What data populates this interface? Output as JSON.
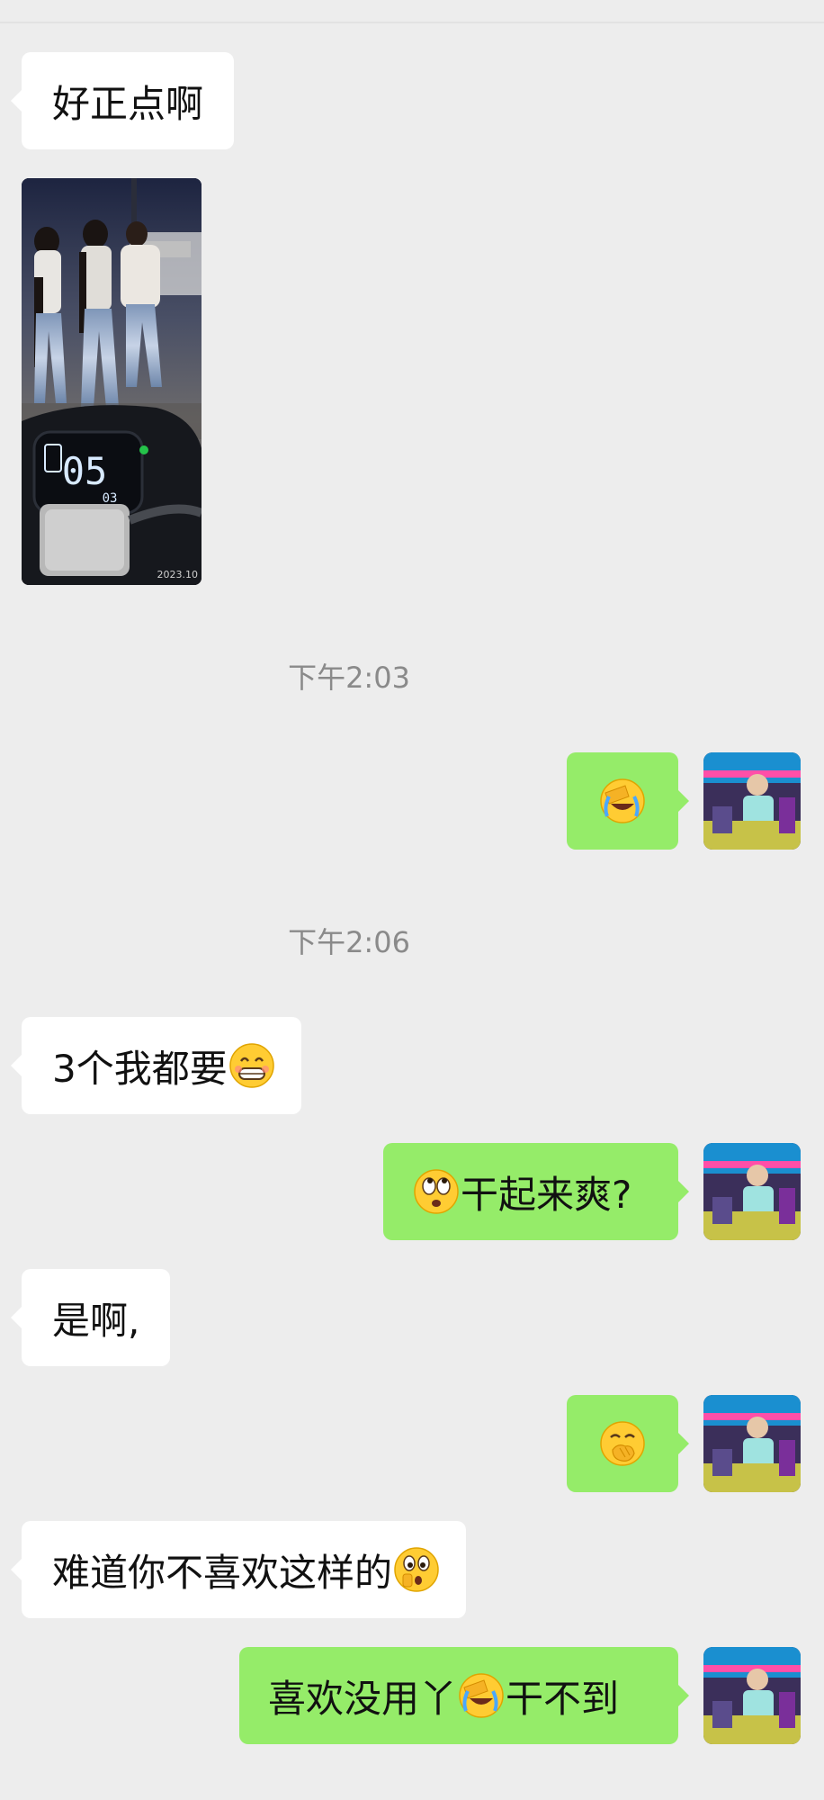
{
  "messages": {
    "m1_text": "好正点啊",
    "m3_text": "3个我都要",
    "m4_text": "干起来爽?",
    "m5_text": "是啊,",
    "m7_text": "难道你不喜欢这样的",
    "m8_part1": "喜欢没用丫",
    "m8_part2": "干不到"
  },
  "photo": {
    "display_big": "05",
    "display_small": "03",
    "watermark": "2023.10"
  },
  "timestamps": [
    "下午2:03",
    "下午2:06"
  ],
  "emojis": {
    "facepalm": "facepalm-crying-emoji",
    "grin": "grinning-teeth-emoji",
    "rolling_eyes": "rolling-eyes-emoji",
    "hand_over_mouth": "hand-over-mouth-emoji",
    "surprised": "surprised-emoji"
  },
  "colors": {
    "background": "#ededed",
    "incoming_bubble": "#ffffff",
    "outgoing_bubble": "#95ec69",
    "timestamp_text": "#8a8a8a"
  }
}
